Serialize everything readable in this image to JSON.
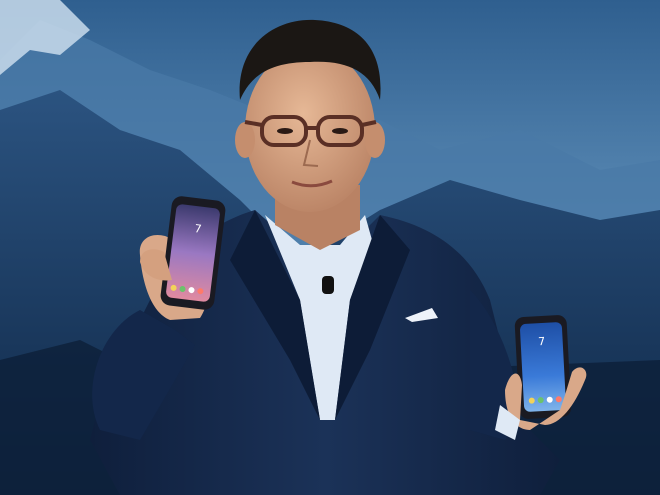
{
  "photo": {
    "subject": "presenter-holding-two-smartphones",
    "backdrop": "blue-mountain-landscape-screen",
    "colors": {
      "sky": "#3b6f9e",
      "mountain": "#1c3d66",
      "snow": "#c9dcec",
      "suit": "#132544",
      "shirt": "#dfe9f5",
      "skin": "#d9a889",
      "hair": "#1b1714",
      "phone_left_screen": "#8a6fb8",
      "phone_right_screen": "#2f6fd0"
    },
    "left_phone": {
      "clock": "7"
    },
    "right_phone": {
      "clock": "7"
    }
  }
}
